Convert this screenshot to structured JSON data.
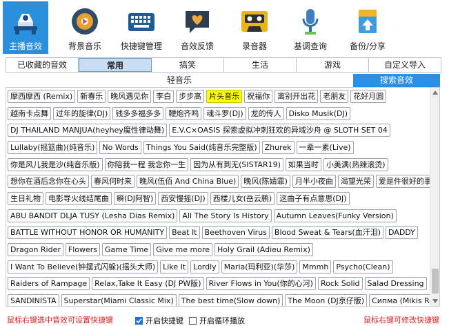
{
  "toolbar": {
    "items": [
      {
        "label": "主播音效",
        "icon": "microphone-icon",
        "active": true
      },
      {
        "label": "背景音乐",
        "icon": "music-disc-icon"
      },
      {
        "label": "快捷键管理",
        "icon": "keyboard-icon"
      },
      {
        "label": "音效反馈",
        "icon": "heart-chat-icon"
      },
      {
        "label": "录音器",
        "icon": "cassette-icon"
      },
      {
        "label": "基调查询",
        "icon": "podcast-mic-icon"
      },
      {
        "label": "备份/分享",
        "icon": "upload-file-icon"
      }
    ]
  },
  "categories": [
    {
      "label": "已收藏的音效"
    },
    {
      "label": "常用",
      "active": true
    },
    {
      "label": "搞笑"
    },
    {
      "label": "生活"
    },
    {
      "label": "游戏"
    },
    {
      "label": "自定义导入"
    }
  ],
  "subtitle": "轻音乐",
  "search_button": "搜索音效",
  "tag_rows": [
    [
      "摩西摩西 (Remix)",
      "新春乐",
      "晚风遇见你",
      "李白",
      "步步高",
      {
        "t": "片头音乐",
        "hl": true
      },
      "祝福你",
      "离别开出花",
      "老朋友",
      "花好月圆"
    ],
    [
      "越南卡点舞",
      "过年的旋律(DJ)",
      "钱多多福多多",
      "鞭炮齐鸣",
      "魂斗罗(DJ)",
      "龙的传人",
      "Disko Musik(DJ)"
    ],
    [
      "DJ THAILAND MANJUA(heyhey魔性律动舞)",
      "E.V.C×OASIS 探索虚拟冲刺狂欢的异域沙舟 @ SLOTH SET 04"
    ],
    [
      "Lullaby(摇篮曲)(纯音乐)",
      "No Words",
      "Things You Said(纯音乐完整版)",
      "Zhurek",
      "一辈一素(Live)"
    ],
    [
      "你是风儿我是沙(纯音乐版)",
      "你陪我一程 我念你一生",
      "因为从有到无(SISTAR19)",
      "如果当时",
      "小美满(热辣滚烫)"
    ],
    [
      "想你在酒后念你在心头",
      "春风何时来",
      "晚风(伍佰 And China Blue)",
      "晚风(陈婧霏)",
      "月半小夜曲",
      "渴望光荣",
      "爱是件很好的事"
    ],
    [
      "生日礼物",
      "电影导火线结尾曲",
      "瞬(DJ阿智)",
      "西安慢摇(DJ)",
      "西楼儿女(岳云鹏)",
      "这曲子有点意思(DJ)"
    ],
    [
      "ABU BANDIT DLJA TUSY (Lesha Dias Remix)",
      "All The Story Is History",
      "Autumn Leaves(Funky Version)"
    ],
    [
      "BATTLE WITHOUT HONOR OR HUMANITY",
      "Beat It",
      "Beethoven Virus",
      "Blood Sweat & Tears(血汗泪)",
      "DADDY"
    ],
    [
      "Dragon Rider",
      "Flowers",
      "Game Time",
      "Give me more",
      "Holy Grail (Adieu Remix)"
    ],
    [
      "I Want To Believe(钟摆式闪躲)(摇头大师)",
      "Like It",
      "Lordly",
      "Maria(玛利亚)(华莎)",
      "Mmmh",
      "Psycho(Clean)"
    ],
    [
      "Raiders of Rampage",
      "Relax,Take It Easy (DJ PW版)",
      "River Flows in You(你的心河)",
      "Rock Solid",
      "Salad Dressing"
    ],
    [
      "SANDINISTA",
      "Superstar(Miami Classic Mix)",
      "The best time(Slow down)",
      "The Moon (DJ京仔版)",
      "Сипма (Mikis Remix)"
    ]
  ],
  "footer": {
    "hint_left": "鼠标右键选中音效可设置快捷键",
    "hotkey_checkbox": "开启快捷键",
    "hotkey_checked": true,
    "loop_checkbox": "开启循环播放",
    "loop_checked": false,
    "hint_right": "鼠标右键可修改快捷键"
  },
  "colors": {
    "accent": "#2a90de",
    "highlight": "#ffff00",
    "hint": "#e02020"
  }
}
